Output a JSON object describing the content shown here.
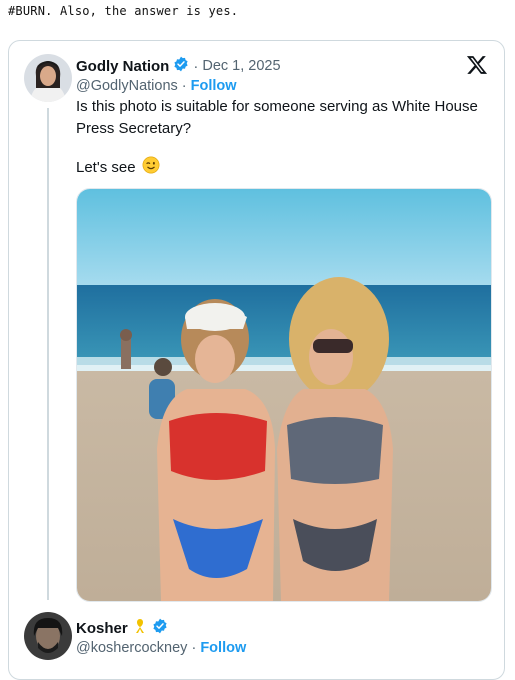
{
  "page": {
    "comment": "#BURN. Also, the answer is yes."
  },
  "tweet": {
    "author_name": "Godly Nation",
    "handle": "@GodlyNations",
    "date": "Dec 1, 2025",
    "follow_label": "Follow",
    "body": "Is this photo is suitable for someone serving as White House Press Secretary?",
    "footer_text": "Let's see",
    "emoji": "winking-face",
    "media": "photo of two women in swimsuits on a beach"
  },
  "reply": {
    "author_name": "Kosher",
    "handle": "@koshercockney",
    "follow_label": "Follow"
  },
  "colors": {
    "accent": "#1d9bf0",
    "border": "#cfd9de",
    "muted": "#536471"
  }
}
